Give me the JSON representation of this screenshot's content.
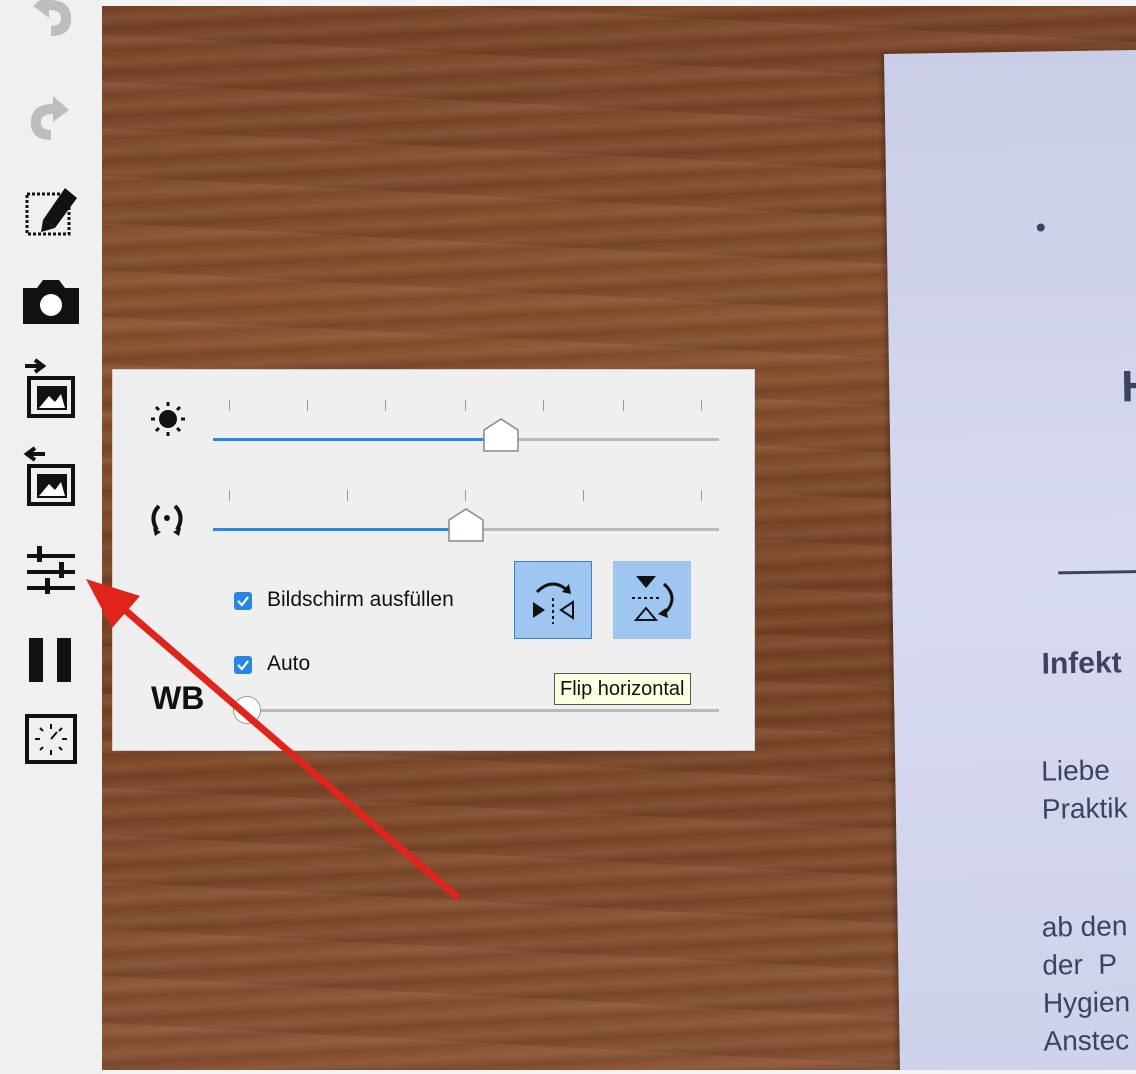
{
  "toolbar": {
    "buttons": [
      {
        "name": "undo-button",
        "icon": "undo-icon"
      },
      {
        "name": "redo-button",
        "icon": "redo-icon"
      },
      {
        "name": "select-edit-button",
        "icon": "selection-edit-icon"
      },
      {
        "name": "snapshot-button",
        "icon": "camera-icon"
      },
      {
        "name": "import-image-button",
        "icon": "image-import-icon"
      },
      {
        "name": "export-image-button",
        "icon": "image-export-icon"
      },
      {
        "name": "settings-button",
        "icon": "sliders-icon"
      },
      {
        "name": "pause-button",
        "icon": "pause-icon"
      },
      {
        "name": "timelapse-button",
        "icon": "timer-icon"
      }
    ]
  },
  "popup": {
    "brightness": {
      "icon": "brightness-icon",
      "value_fraction": 0.57
    },
    "rotation": {
      "icon": "rotation-icon",
      "value_fraction": 0.5
    },
    "fill_screen": {
      "label": "Bildschirm ausfüllen",
      "checked": true
    },
    "auto_wb": {
      "label": "Auto",
      "checked": true
    },
    "wb_label": "WB",
    "wb_value_fraction": 0.0,
    "flip_horizontal_icon": "flip-horizontal-icon",
    "flip_vertical_icon": "flip-vertical-icon",
    "tooltip": "Flip horizontal"
  },
  "document": {
    "heading_fragment": "H",
    "subheading_fragment": "Infekt",
    "line1": "Liebe",
    "line2": "Praktik",
    "line3": "ab den",
    "line4": "der  P",
    "line5": "Hygien",
    "line6": "Anstec"
  },
  "colors": {
    "accent": "#2a86e6",
    "button_active": "#9ec6f0",
    "annotation_arrow": "#e0241b"
  }
}
